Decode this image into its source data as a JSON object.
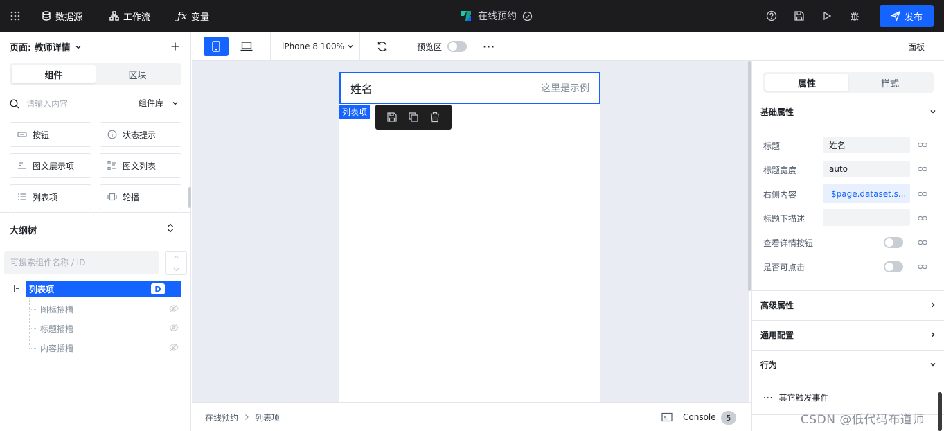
{
  "topbar": {
    "datasource": "数据源",
    "workflow": "工作流",
    "variables": "变量",
    "app_title": "在线预约",
    "publish": "发布"
  },
  "left": {
    "page_label": "页面: 教师详情",
    "tabs": [
      "组件",
      "区块"
    ],
    "search_placeholder": "请输入内容",
    "library": "组件库",
    "components": [
      {
        "label": "按钮",
        "icon": "button-icon"
      },
      {
        "label": "状态提示",
        "icon": "info-icon"
      },
      {
        "label": "图文展示项",
        "icon": "image-text-icon"
      },
      {
        "label": "图文列表",
        "icon": "image-list-icon"
      },
      {
        "label": "列表项",
        "icon": "list-icon"
      },
      {
        "label": "轮播",
        "icon": "carousel-icon"
      }
    ],
    "outline_title": "大纲树",
    "outline_search_placeholder": "可搜索组件名称 / ID",
    "tree": {
      "root": "列表项",
      "root_badge": "D",
      "children": [
        "图标插槽",
        "标题插槽",
        "内容插槽"
      ]
    }
  },
  "toolbar": {
    "device": "iPhone 8 100%",
    "preview": "预览区",
    "more": "···",
    "panel": "面板"
  },
  "canvas": {
    "item_title": "姓名",
    "item_extra": "这里是示例",
    "selected_tag": "列表项"
  },
  "statusbar": {
    "crumbs": [
      "在线预约",
      "列表项"
    ],
    "console": "Console",
    "console_count": "5"
  },
  "right": {
    "tabs": [
      "属性",
      "样式"
    ],
    "basic_title": "基础属性",
    "props": [
      {
        "label": "标题",
        "value": "姓名",
        "type": "input"
      },
      {
        "label": "标题宽度",
        "value": "auto",
        "type": "input"
      },
      {
        "label": "右侧内容",
        "value": "$page.dataset.s...",
        "type": "expr"
      },
      {
        "label": "标题下描述",
        "value": "",
        "type": "input"
      },
      {
        "label": "查看详情按钮",
        "value": false,
        "type": "switch"
      },
      {
        "label": "是否可点击",
        "value": false,
        "type": "switch"
      }
    ],
    "advanced_title": "高级属性",
    "common_title": "通用配置",
    "behavior_title": "行为",
    "other_events": "其它触发事件"
  },
  "watermark": "CSDN @低代码布道师",
  "colors": {
    "accent": "#1664ff",
    "topbar_bg": "#1c1c1e",
    "canvas_bg": "#e9edf3",
    "border": "#e5e6eb"
  }
}
